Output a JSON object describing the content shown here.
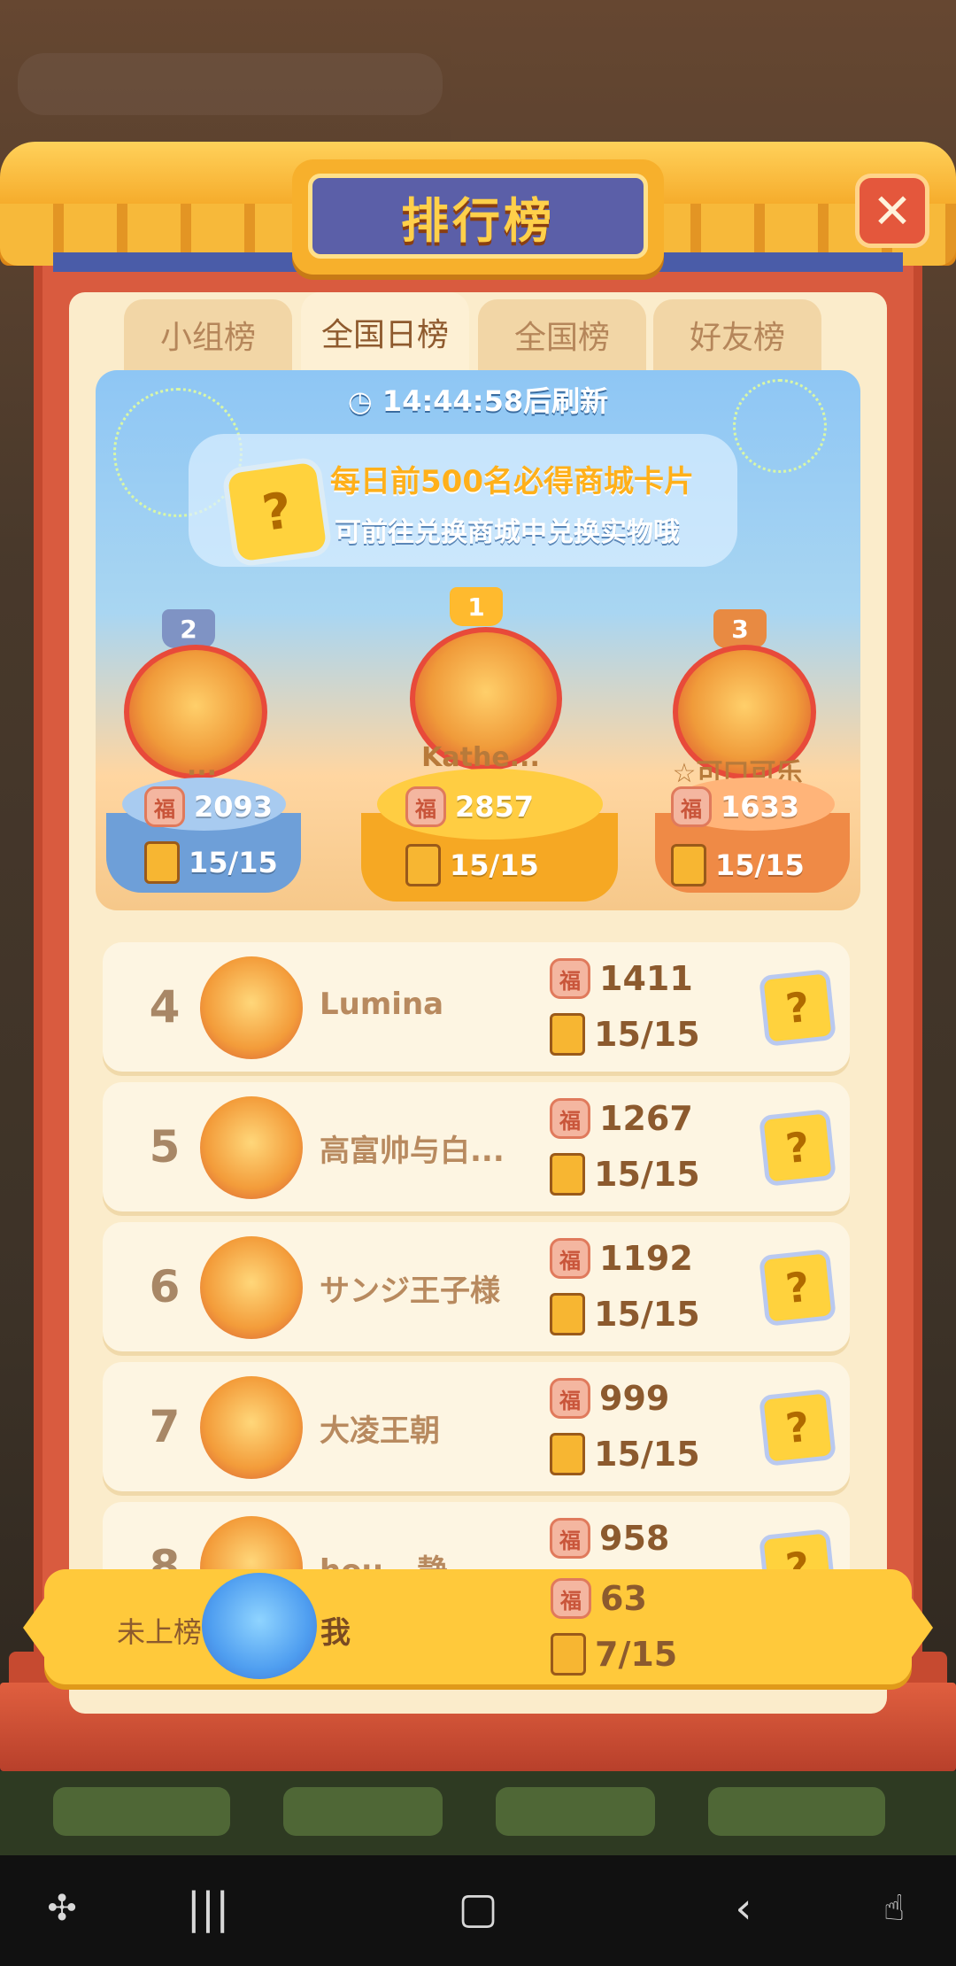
{
  "title": "排行榜",
  "close_label": "✕",
  "tabs": [
    {
      "label": "小组榜",
      "active": false
    },
    {
      "label": "全国日榜",
      "active": true
    },
    {
      "label": "全国榜",
      "active": false
    },
    {
      "label": "好友榜",
      "active": false
    }
  ],
  "refresh_text": "14:44:58后刷新",
  "banner": {
    "line1": "每日前500名必得商城卡片",
    "line2": "可前往兑换商城中兑换实物哦"
  },
  "podium": [
    {
      "rank": "2",
      "name": "...",
      "score": "2093",
      "progress": "15/15"
    },
    {
      "rank": "1",
      "name": "Kathe...",
      "score": "2857",
      "progress": "15/15"
    },
    {
      "rank": "3",
      "name": "☆可口可乐",
      "score": "1633",
      "progress": "15/15"
    }
  ],
  "rows": [
    {
      "rank": "4",
      "name": "Lumina",
      "score": "1411",
      "progress": "15/15"
    },
    {
      "rank": "5",
      "name": "高富帅与白...",
      "score": "1267",
      "progress": "15/15"
    },
    {
      "rank": "6",
      "name": "サンジ王子様",
      "score": "1192",
      "progress": "15/15"
    },
    {
      "rank": "7",
      "name": "大凌王朝",
      "score": "999",
      "progress": "15/15"
    },
    {
      "rank": "8",
      "name": "hou...静",
      "score": "958",
      "progress": ""
    }
  ],
  "me": {
    "rank_label": "未上榜",
    "name": "我",
    "score": "63",
    "progress": "7/15"
  },
  "icons": {
    "fu": "福",
    "card": "?"
  },
  "colors": {
    "accent": "#ffc93b",
    "frame": "#d95b3f",
    "title_bg": "#5b5fa8"
  }
}
